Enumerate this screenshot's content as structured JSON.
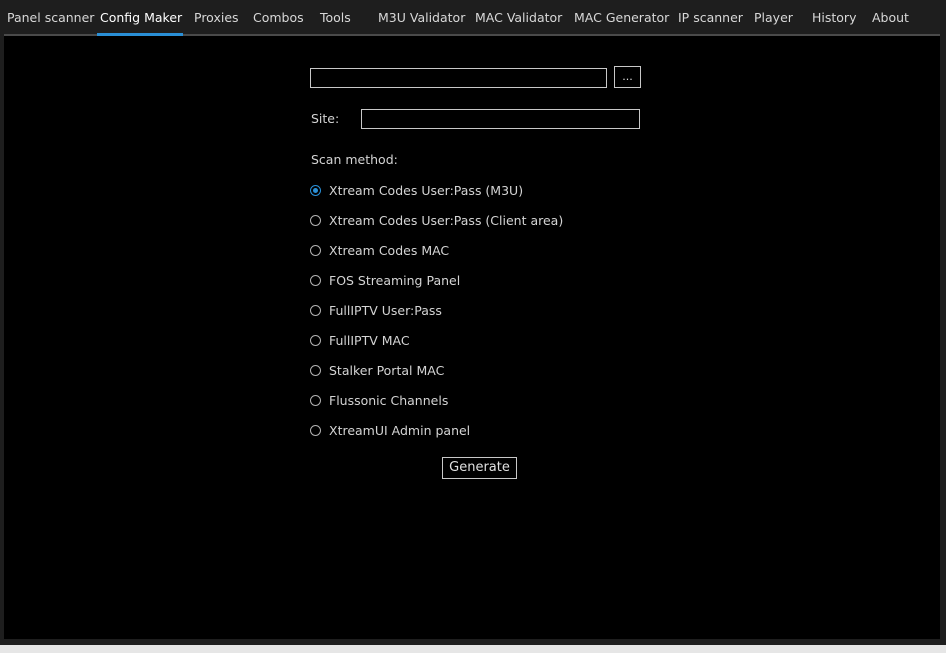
{
  "tabs": [
    {
      "label": "Panel scanner"
    },
    {
      "label": "Config Maker"
    },
    {
      "label": "Proxies"
    },
    {
      "label": "Combos"
    },
    {
      "label": "Tools"
    },
    {
      "label": "M3U Validator"
    },
    {
      "label": "MAC Validator"
    },
    {
      "label": "MAC Generator"
    },
    {
      "label": "IP scanner"
    },
    {
      "label": "Player"
    },
    {
      "label": "History"
    },
    {
      "label": "About"
    }
  ],
  "active_tab": "Config Maker",
  "file_input": {
    "value": "",
    "browse_label": "..."
  },
  "site": {
    "label": "Site:",
    "value": ""
  },
  "scan_method": {
    "label": "Scan method:",
    "options": [
      {
        "label": "Xtream Codes User:Pass (M3U)",
        "checked": true
      },
      {
        "label": "Xtream Codes User:Pass (Client area)",
        "checked": false
      },
      {
        "label": "Xtream Codes MAC",
        "checked": false
      },
      {
        "label": "FOS Streaming Panel",
        "checked": false
      },
      {
        "label": "FullIPTV User:Pass",
        "checked": false
      },
      {
        "label": "FullIPTV MAC",
        "checked": false
      },
      {
        "label": "Stalker Portal MAC",
        "checked": false
      },
      {
        "label": "Flussonic Channels",
        "checked": false
      },
      {
        "label": "XtreamUI Admin panel",
        "checked": false
      }
    ]
  },
  "generate_label": "Generate",
  "colors": {
    "accent": "#2a8fd6",
    "background": "#000000",
    "chrome": "#1e1e1e"
  }
}
